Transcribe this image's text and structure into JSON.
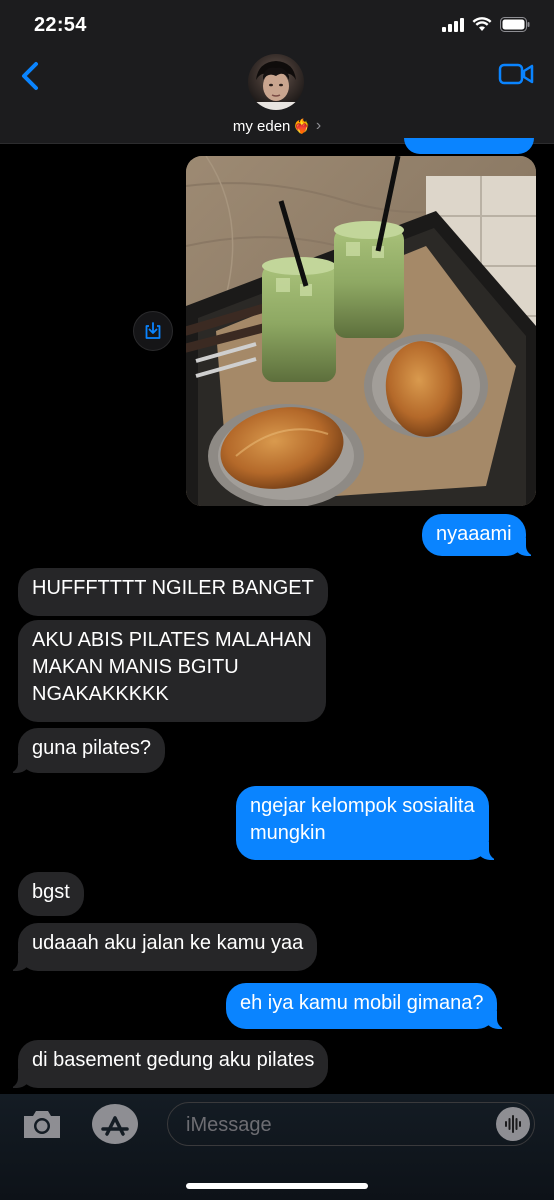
{
  "status_bar": {
    "time": "22:54"
  },
  "header": {
    "contact_name": "my eden",
    "heart_emoji": "❤️‍🔥",
    "chevron": "›"
  },
  "photo": {
    "description_icon": "photo-attachment",
    "content": "two iced matcha lattes and salt bread rolls on a tray"
  },
  "messages": [
    {
      "id": "m1",
      "direction": "outgoing",
      "text": "nyaaami"
    },
    {
      "id": "m2",
      "direction": "incoming",
      "text": "HUFFFTTTT NGILER BANGET"
    },
    {
      "id": "m3",
      "direction": "incoming",
      "text": "AKU ABIS PILATES MALAHAN\nMAKAN MANIS BGITU\nNGAKAKKKKK"
    },
    {
      "id": "m4",
      "direction": "incoming",
      "text": "guna pilates?"
    },
    {
      "id": "m5",
      "direction": "outgoing",
      "text": "ngejar kelompok sosialita\nmungkin"
    },
    {
      "id": "m6",
      "direction": "incoming",
      "text": "bgst"
    },
    {
      "id": "m7",
      "direction": "incoming",
      "text": "udaaah aku jalan ke kamu yaa"
    },
    {
      "id": "m8",
      "direction": "outgoing",
      "text": "eh iya kamu mobil gimana?"
    },
    {
      "id": "m9",
      "direction": "incoming",
      "text": "di basement gedung aku pilates"
    }
  ],
  "input": {
    "placeholder": "iMessage"
  },
  "colors": {
    "outgoing": "#0a84ff",
    "incoming": "#262628",
    "background": "#000000"
  }
}
